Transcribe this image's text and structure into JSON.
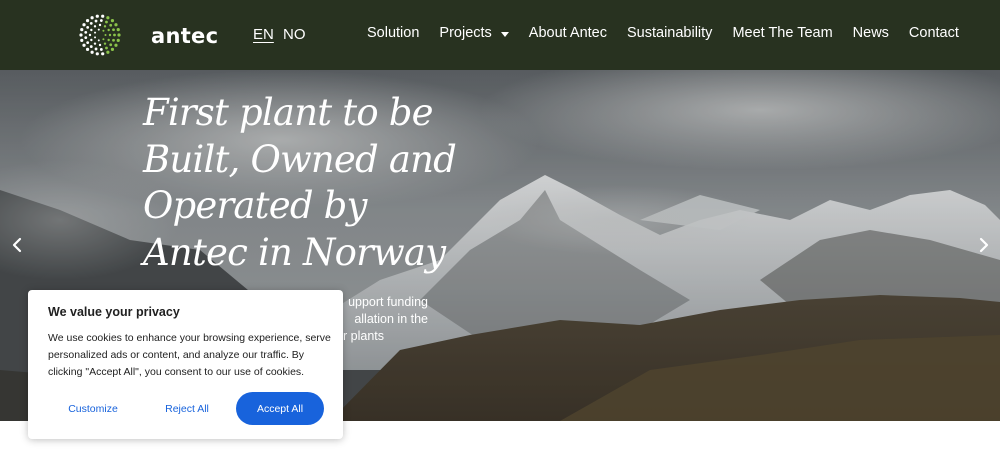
{
  "header": {
    "brand": "antec",
    "languages": [
      {
        "label": "EN",
        "active": true
      },
      {
        "label": "NO",
        "active": false
      }
    ],
    "nav": [
      {
        "label": "Solution",
        "has_dropdown": false
      },
      {
        "label": "Projects",
        "has_dropdown": true
      },
      {
        "label": "About Antec",
        "has_dropdown": false
      },
      {
        "label": "Sustainability",
        "has_dropdown": false
      },
      {
        "label": "Meet The Team",
        "has_dropdown": false
      },
      {
        "label": "News",
        "has_dropdown": false
      },
      {
        "label": "Contact",
        "has_dropdown": false
      }
    ]
  },
  "hero": {
    "title": "First plant to be Built, Owned and Operated by Antec in Norway",
    "text_fragments": [
      "upport funding",
      "allation in the",
      "r plants"
    ]
  },
  "cookie": {
    "title": "We value your privacy",
    "text": "We use cookies to enhance your browsing experience, serve personalized ads or content, and analyze our traffic. By clicking \"Accept All\", you consent to our use of cookies.",
    "customize_label": "Customize",
    "reject_label": "Reject All",
    "accept_label": "Accept All"
  },
  "icons": {
    "logo": "dotted-circle-logo",
    "prev": "chevron-left-icon",
    "next": "chevron-right-icon",
    "dropdown": "caret-down-icon"
  },
  "colors": {
    "header_bg": "#283220",
    "accent": "#1863dc",
    "logo_green": "#8bc34a"
  }
}
